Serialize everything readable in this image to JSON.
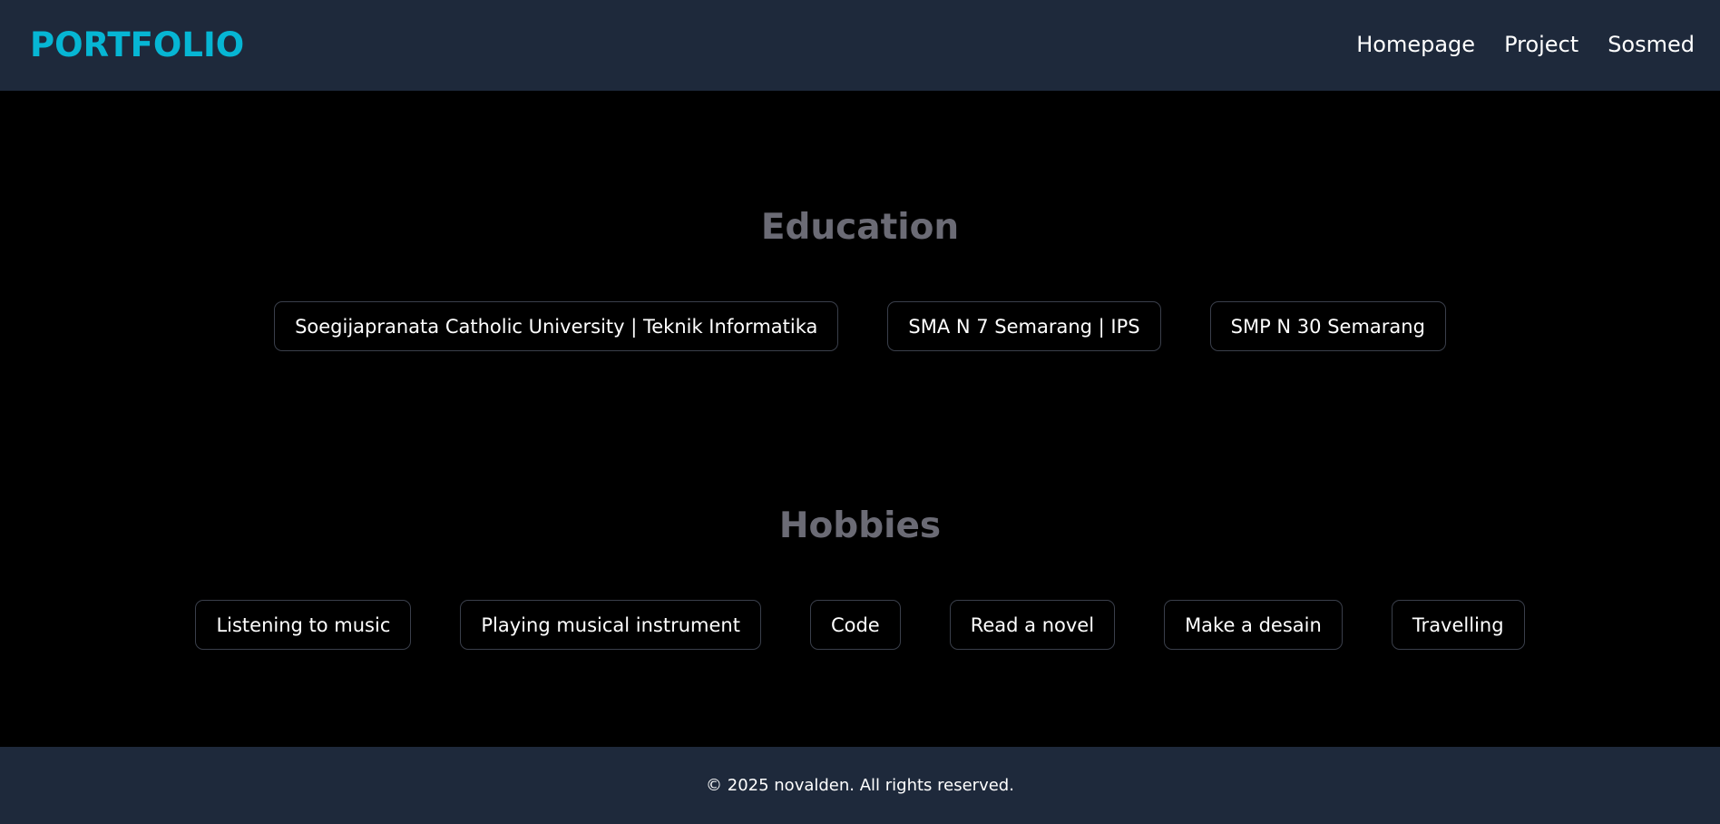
{
  "header": {
    "logo": "PORTFOLIO",
    "nav": [
      {
        "label": "Homepage"
      },
      {
        "label": "Project"
      },
      {
        "label": "Sosmed"
      }
    ]
  },
  "education": {
    "title": "Education",
    "items": [
      {
        "label": "Soegijapranata Catholic University | Teknik Informatika"
      },
      {
        "label": "SMA N 7 Semarang | IPS"
      },
      {
        "label": "SMP N 30 Semarang"
      }
    ]
  },
  "hobbies": {
    "title": "Hobbies",
    "items": [
      {
        "label": "Listening to music"
      },
      {
        "label": "Playing musical instrument"
      },
      {
        "label": "Code"
      },
      {
        "label": "Read a novel"
      },
      {
        "label": "Make a desain"
      },
      {
        "label": "Travelling"
      }
    ]
  },
  "footer": {
    "text": "© 2025 novalden. All rights reserved."
  },
  "colors": {
    "accent": "#06b6d4",
    "navbar_bg": "#1e293b",
    "page_bg": "#000000",
    "section_title": "#6b6b75",
    "chip_border": "#3a3f4b"
  }
}
